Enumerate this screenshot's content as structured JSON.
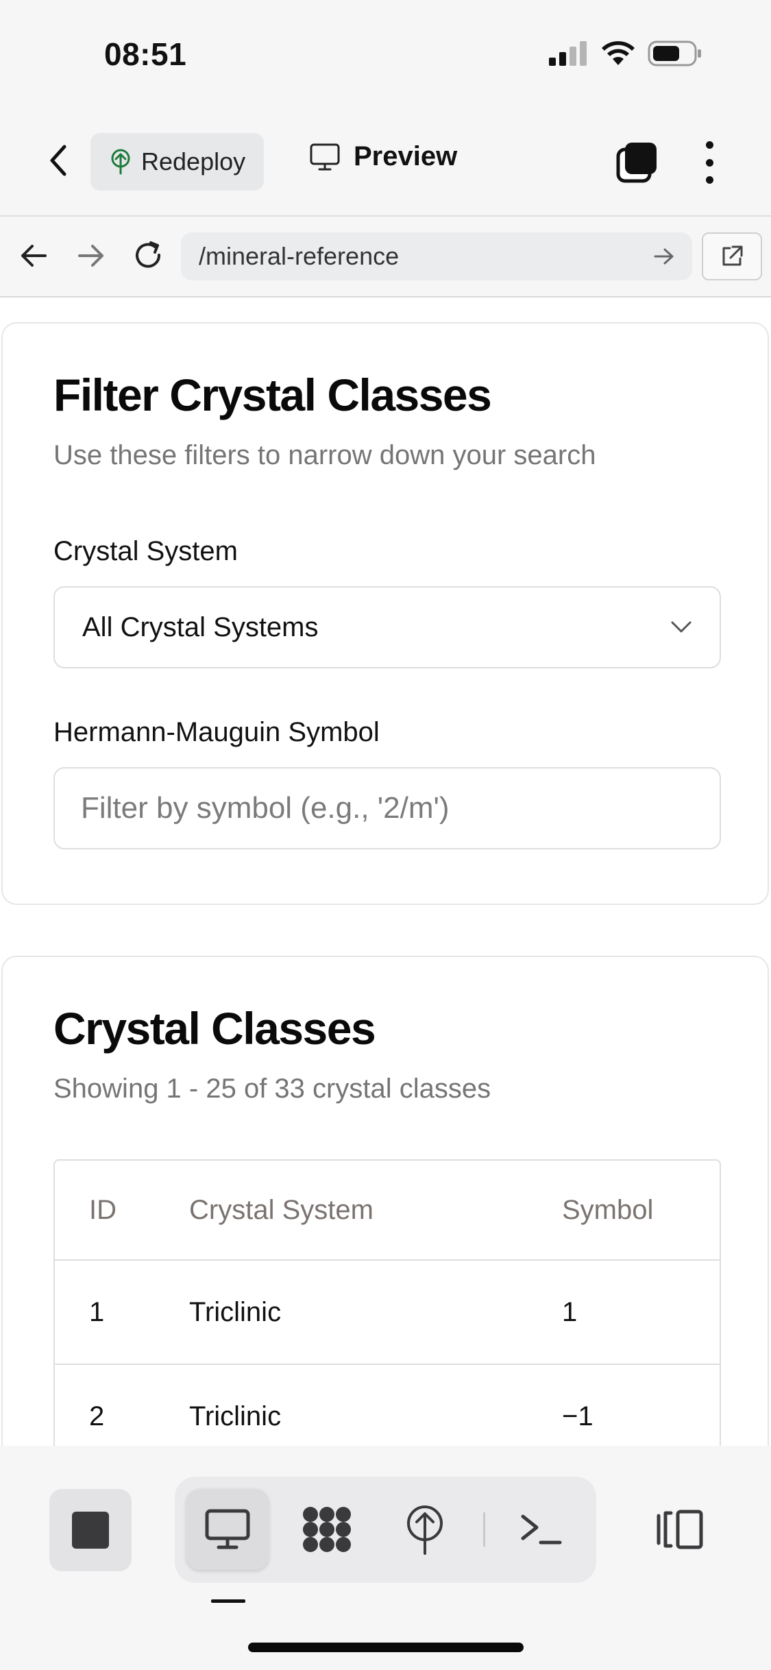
{
  "status_bar": {
    "time": "08:51"
  },
  "top_bar": {
    "redeploy_label": "Redeploy",
    "preview_label": "Preview"
  },
  "browser": {
    "url": "/mineral-reference"
  },
  "filter_card": {
    "title": "Filter Crystal Classes",
    "subtitle": "Use these filters to narrow down your search",
    "crystal_system_label": "Crystal System",
    "crystal_system_value": "All Crystal Systems",
    "symbol_label": "Hermann-Mauguin Symbol",
    "symbol_placeholder": "Filter by symbol (e.g., '2/m')"
  },
  "classes_card": {
    "title": "Crystal Classes",
    "subtitle": "Showing 1 - 25 of 33 crystal classes",
    "columns": [
      "ID",
      "Crystal System",
      "Symbol"
    ],
    "rows": [
      {
        "id": "1",
        "system": "Triclinic",
        "symbol": "1"
      },
      {
        "id": "2",
        "system": "Triclinic",
        "symbol": "−1"
      }
    ]
  },
  "bottom_toolbar": {
    "icons": [
      "stop-icon",
      "desktop-icon",
      "network-icon",
      "deploy-icon",
      "terminal-icon",
      "split-view-icon"
    ]
  }
}
